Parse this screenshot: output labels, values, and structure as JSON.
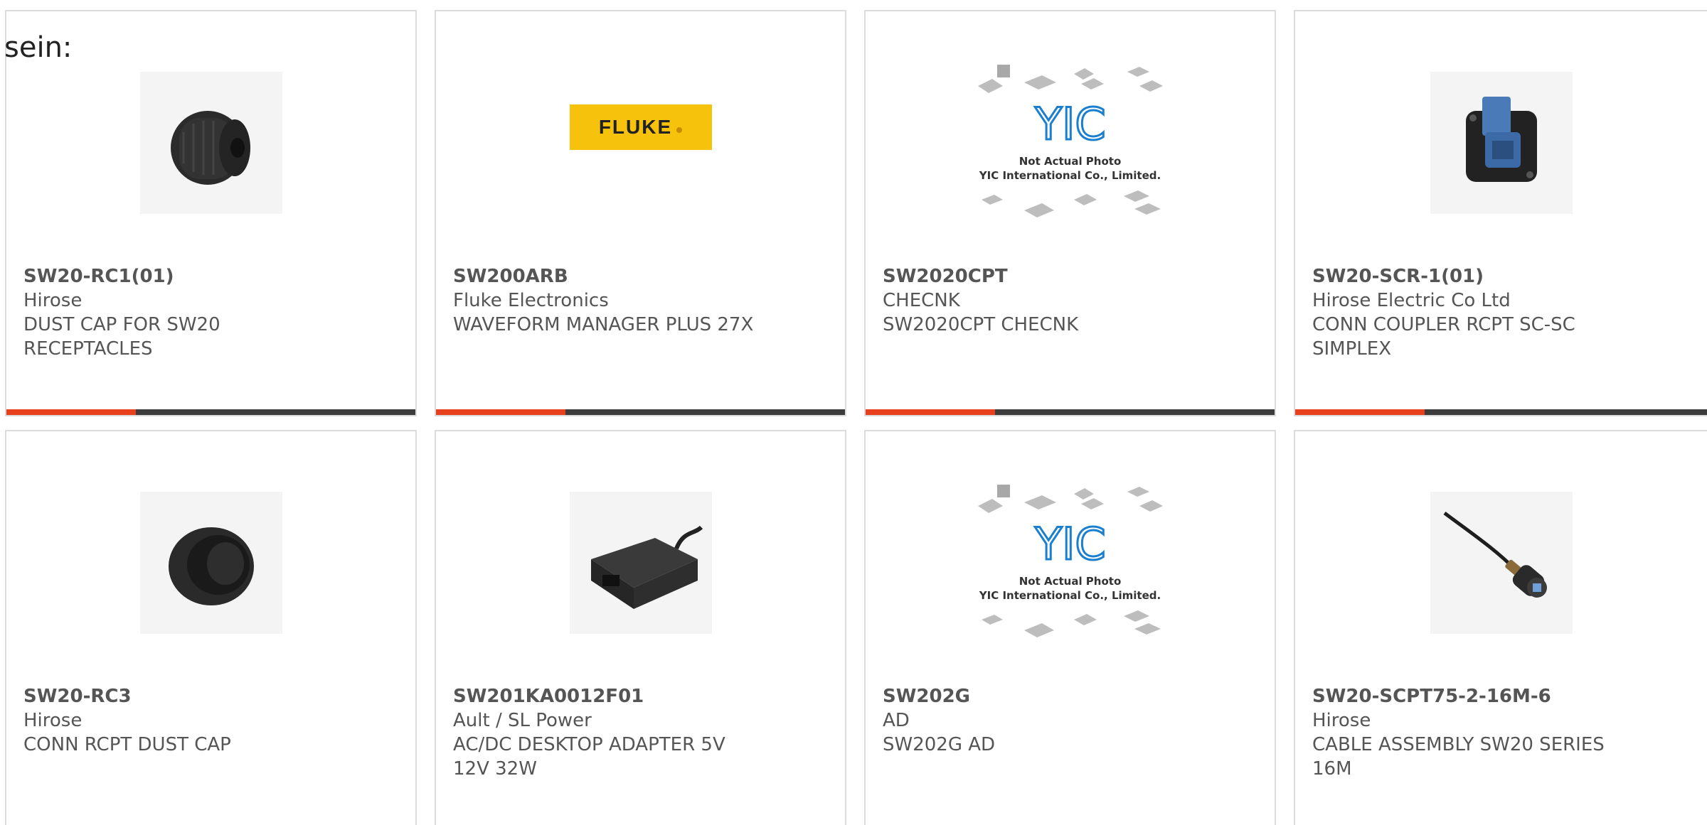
{
  "intro_text": "sein:",
  "colors": {
    "accent": "#e8401c",
    "bar": "#3c3c3c",
    "fluke_yellow": "#f6c20c",
    "yic_blue": "#1b7fd0"
  },
  "products": [
    {
      "part_number": "SW20-RC1(01)",
      "manufacturer": "Hirose",
      "desc1": "DUST CAP FOR SW20",
      "desc2": "RECEPTACLES",
      "image": "dust-cap-photo"
    },
    {
      "part_number": "SW200ARB",
      "manufacturer": "Fluke Electronics",
      "desc1": "WAVEFORM MANAGER PLUS 27X",
      "desc2": "",
      "image": "fluke-logo",
      "logo_text": "FLUKE"
    },
    {
      "part_number": "SW2020CPT",
      "manufacturer": "CHECNK",
      "desc1": "SW2020CPT CHECNK",
      "desc2": "",
      "image": "yic-placeholder",
      "ph_line1": "Not Actual Photo",
      "ph_line2": "YIC International Co., Limited."
    },
    {
      "part_number": "SW20-SCR-1(01)",
      "manufacturer": "Hirose Electric Co Ltd",
      "desc1": "CONN COUPLER RCPT SC-SC",
      "desc2": "SIMPLEX",
      "image": "coupler-photo"
    },
    {
      "part_number": "SW20-RC3",
      "manufacturer": "Hirose",
      "desc1": "CONN RCPT DUST CAP",
      "desc2": "",
      "image": "rcpt-cap-photo"
    },
    {
      "part_number": "SW201KA0012F01",
      "manufacturer": "Ault / SL Power",
      "desc1": "AC/DC DESKTOP ADAPTER 5V",
      "desc2": "12V 32W",
      "image": "adapter-photo"
    },
    {
      "part_number": "SW202G",
      "manufacturer": "AD",
      "desc1": "SW202G AD",
      "desc2": "",
      "image": "yic-placeholder",
      "ph_line1": "Not Actual Photo",
      "ph_line2": "YIC International Co., Limited."
    },
    {
      "part_number": "SW20-SCPT75-2-16M-6",
      "manufacturer": "Hirose",
      "desc1": "CABLE ASSEMBLY SW20 SERIES",
      "desc2": "16M",
      "image": "cable-photo"
    }
  ]
}
